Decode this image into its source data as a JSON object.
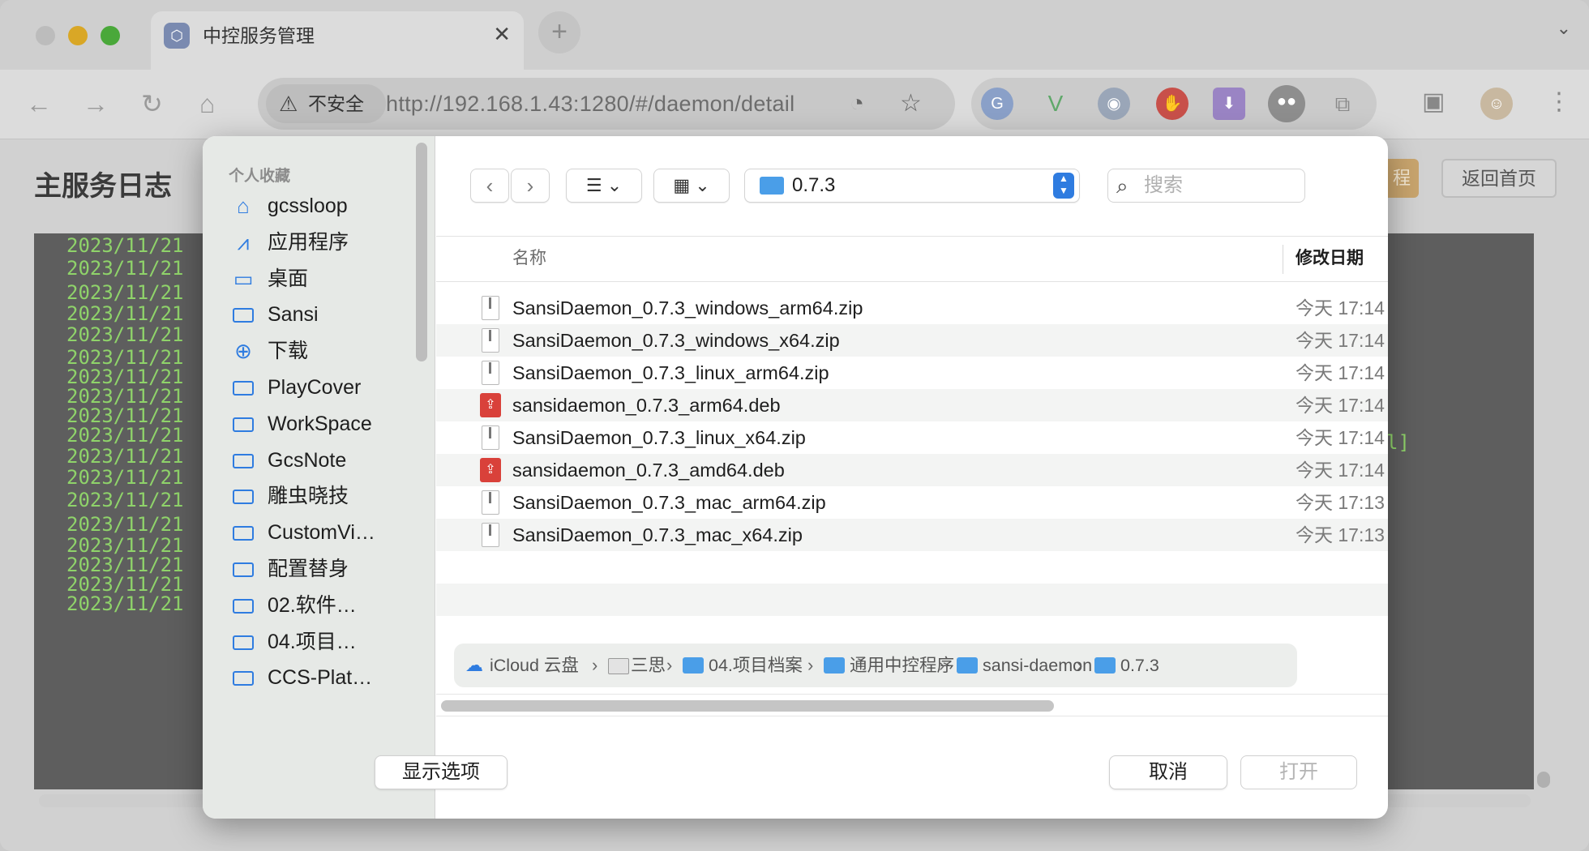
{
  "browser": {
    "tab_title": "中控服务管理",
    "tab_close": "✕",
    "new_tab": "+",
    "security_label": "不安全",
    "url": "http://192.168.1.43:1280/#/daemon/detail"
  },
  "page": {
    "title": "主服务日志",
    "btn_primary_fragment": "程",
    "btn_home": "返回首页",
    "log_date": "2023/11/21",
    "log_tail": "l]",
    "log_count": 18
  },
  "dialog": {
    "sidebar": {
      "heading": "个人收藏",
      "items": [
        {
          "label": "gcssloop",
          "icon": "home-icon"
        },
        {
          "label": "应用程序",
          "icon": "applications-icon"
        },
        {
          "label": "桌面",
          "icon": "desktop-icon"
        },
        {
          "label": "Sansi",
          "icon": "folder-icon"
        },
        {
          "label": "下载",
          "icon": "download-icon"
        },
        {
          "label": "PlayCover",
          "icon": "folder-icon"
        },
        {
          "label": "WorkSpace",
          "icon": "folder-icon"
        },
        {
          "label": "GcsNote",
          "icon": "folder-icon"
        },
        {
          "label": "雕虫晓技",
          "icon": "folder-icon"
        },
        {
          "label": "CustomVi…",
          "icon": "folder-icon"
        },
        {
          "label": "配置替身",
          "icon": "folder-icon"
        },
        {
          "label": "02.软件…",
          "icon": "folder-icon"
        },
        {
          "label": "04.项目…",
          "icon": "folder-icon"
        },
        {
          "label": "CCS-Plat…",
          "icon": "folder-icon"
        }
      ]
    },
    "location": "0.7.3",
    "search_placeholder": "搜索",
    "columns": {
      "name": "名称",
      "date": "修改日期"
    },
    "files": [
      {
        "name": "SansiDaemon_0.7.3_windows_arm64.zip",
        "date": "今天 17:14",
        "type": "zip"
      },
      {
        "name": "SansiDaemon_0.7.3_windows_x64.zip",
        "date": "今天 17:14",
        "type": "zip"
      },
      {
        "name": "SansiDaemon_0.7.3_linux_arm64.zip",
        "date": "今天 17:14",
        "type": "zip"
      },
      {
        "name": "sansidaemon_0.7.3_arm64.deb",
        "date": "今天 17:14",
        "type": "deb"
      },
      {
        "name": "SansiDaemon_0.7.3_linux_x64.zip",
        "date": "今天 17:14",
        "type": "zip"
      },
      {
        "name": "sansidaemon_0.7.3_amd64.deb",
        "date": "今天 17:14",
        "type": "deb"
      },
      {
        "name": "SansiDaemon_0.7.3_mac_arm64.zip",
        "date": "今天 17:13",
        "type": "zip"
      },
      {
        "name": "SansiDaemon_0.7.3_mac_x64.zip",
        "date": "今天 17:13",
        "type": "zip"
      }
    ],
    "path": [
      "iCloud 云盘",
      "三思",
      "04.项目档案",
      "通用中控程序",
      "sansi-daemon",
      "0.7.3"
    ],
    "buttons": {
      "options": "显示选项",
      "cancel": "取消",
      "open": "打开"
    }
  }
}
